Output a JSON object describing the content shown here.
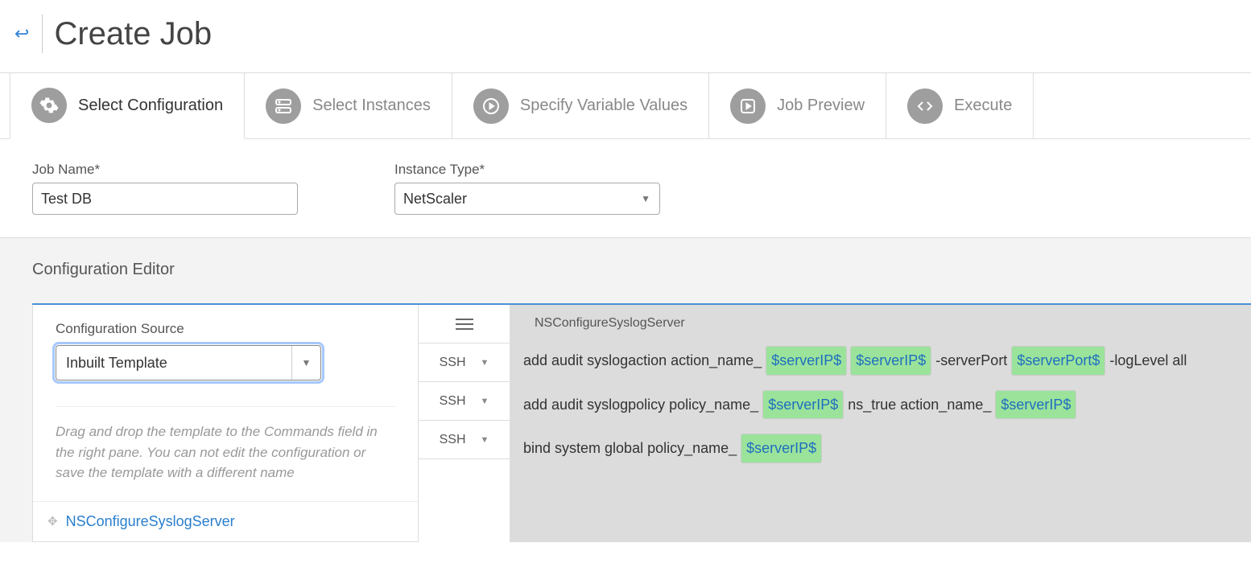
{
  "page": {
    "title": "Create Job"
  },
  "tabs": [
    {
      "label": "Select Configuration",
      "active": true
    },
    {
      "label": "Select Instances",
      "active": false
    },
    {
      "label": "Specify Variable Values",
      "active": false
    },
    {
      "label": "Job Preview",
      "active": false
    },
    {
      "label": "Execute",
      "active": false
    }
  ],
  "form": {
    "job_name_label": "Job Name*",
    "job_name_value": "Test DB",
    "instance_type_label": "Instance Type*",
    "instance_type_value": "NetScaler"
  },
  "editor": {
    "section_title": "Configuration Editor",
    "config_source_label": "Configuration Source",
    "config_source_value": "Inbuilt Template",
    "hint": "Drag and drop the template to the Commands field in the right pane. You can not edit the configuration or save the template with a different name",
    "template_name": "NSConfigureSyslogServer",
    "protocol": "SSH",
    "commands": [
      {
        "segments": [
          {
            "t": "text",
            "v": "add audit syslogaction action_name_"
          },
          {
            "t": "var",
            "v": "$serverIP$"
          },
          {
            "t": "var",
            "v": "$serverIP$"
          },
          {
            "t": "text",
            "v": " -serverPort "
          },
          {
            "t": "var",
            "v": "$serverPort$"
          },
          {
            "t": "text",
            "v": " -logLevel all"
          }
        ]
      },
      {
        "segments": [
          {
            "t": "text",
            "v": "add audit syslogpolicy policy_name_"
          },
          {
            "t": "var",
            "v": "$serverIP$"
          },
          {
            "t": "text",
            "v": " ns_true action_name_"
          },
          {
            "t": "var",
            "v": "$serverIP$"
          }
        ]
      },
      {
        "segments": [
          {
            "t": "text",
            "v": "bind system global policy_name_"
          },
          {
            "t": "var",
            "v": "$serverIP$"
          }
        ]
      }
    ]
  }
}
